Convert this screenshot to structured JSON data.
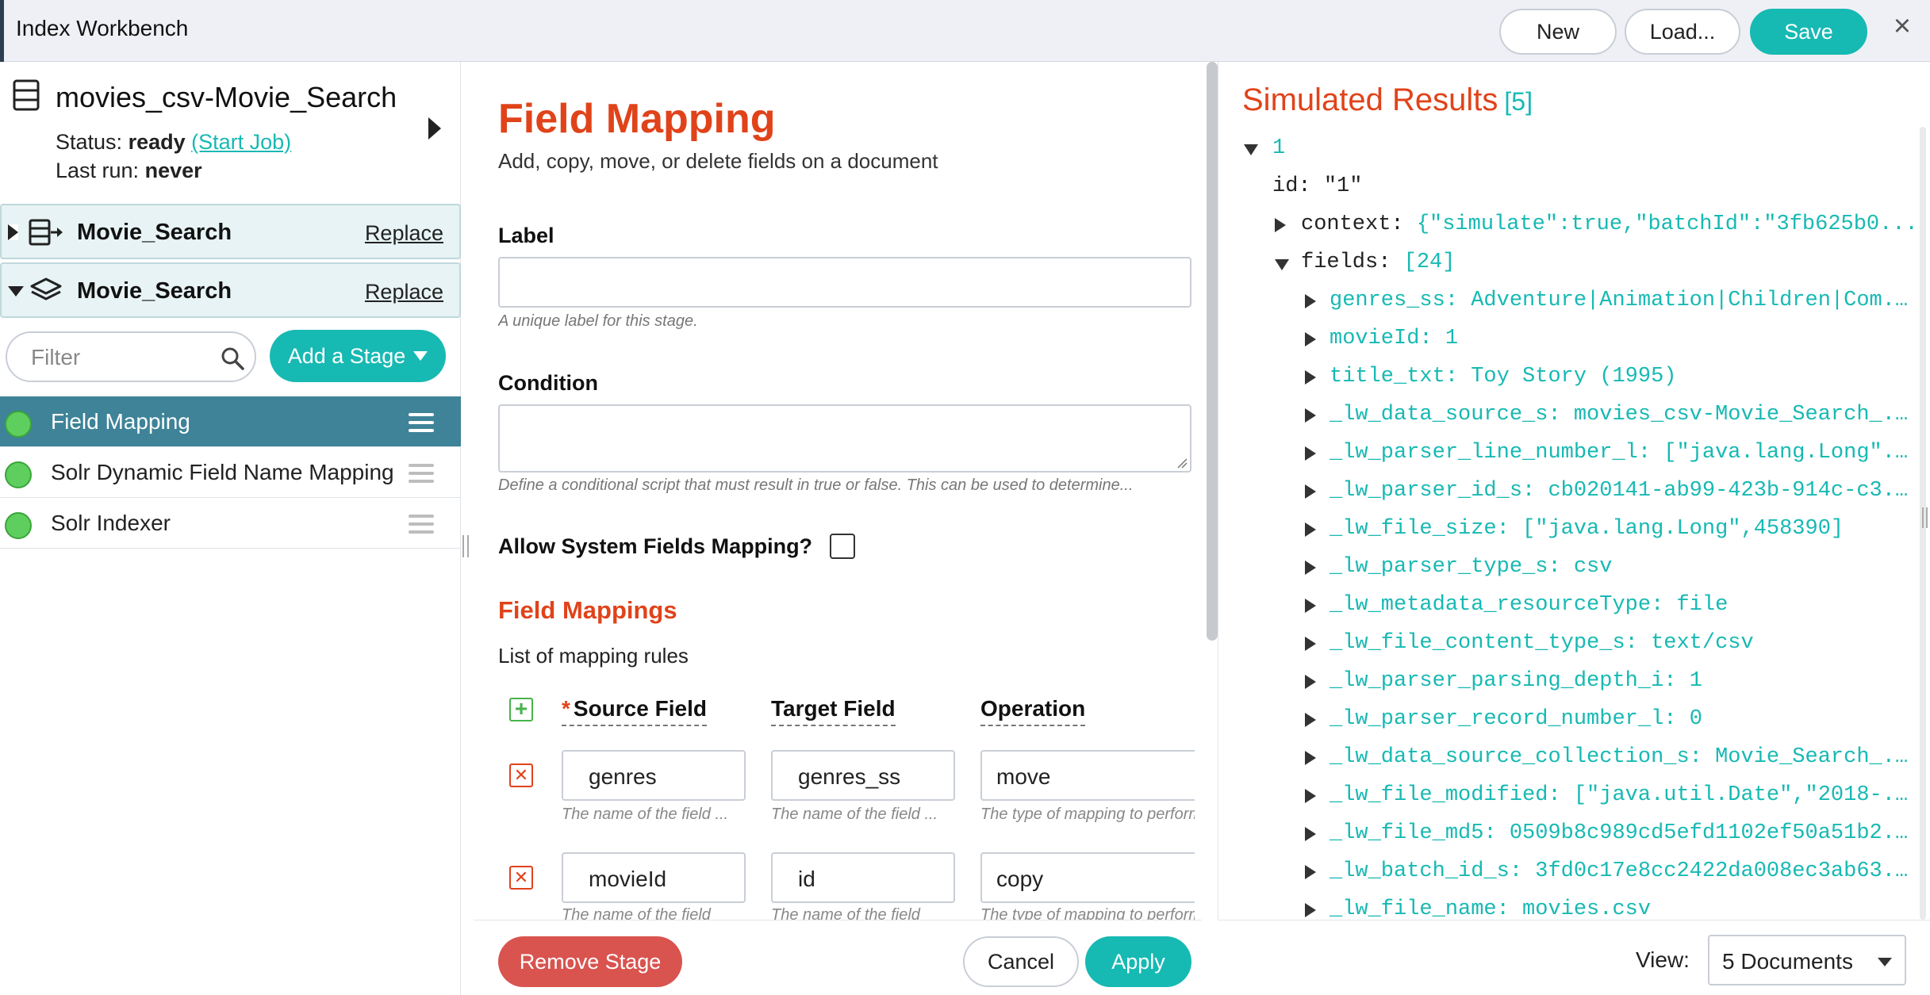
{
  "topbar": {
    "title": "Index Workbench",
    "new_label": "New",
    "load_label": "Load...",
    "save_label": "Save",
    "close_symbol": "×"
  },
  "pipeline": {
    "name": "movies_csv-Movie_Search",
    "status_label": "Status:",
    "status_value": "ready",
    "start_job_label": "(Start Job)",
    "last_run_label": "Last run:",
    "last_run_value": "never"
  },
  "sections": [
    {
      "title": "Movie_Search",
      "action": "Replace",
      "icon": "datasource-icon",
      "expanded": false
    },
    {
      "title": "Movie_Search",
      "action": "Replace",
      "icon": "layers-icon",
      "expanded": true
    }
  ],
  "filter": {
    "placeholder": "Filter"
  },
  "add_stage_label": "Add a Stage",
  "stages": [
    {
      "name": "Field Mapping",
      "active": true
    },
    {
      "name": "Solr Dynamic Field Name Mapping",
      "active": false
    },
    {
      "name": "Solr Indexer",
      "active": false
    }
  ],
  "form": {
    "title": "Field Mapping",
    "subtitle": "Add, copy, move, or delete fields on a document",
    "label_title": "Label",
    "label_value": "",
    "label_hint": "A unique label for this stage.",
    "condition_title": "Condition",
    "condition_value": "",
    "condition_hint": "Define a conditional script that must result in true or false. This can be used to determine...",
    "allow_system_label": "Allow System Fields Mapping?",
    "allow_system_checked": false,
    "mappings_title": "Field Mappings",
    "mappings_sub": "List of mapping rules",
    "columns": {
      "required_mark": "*",
      "source": "Source Field",
      "target": "Target Field",
      "operation": "Operation"
    },
    "rows": [
      {
        "source": "genres",
        "target": "genres_ss",
        "operation": "move",
        "source_hint": "The name of the field ...",
        "target_hint": "The name of the field ...",
        "operation_hint": "The type of mapping to perform"
      },
      {
        "source": "movieId",
        "target": "id",
        "operation": "copy",
        "source_hint": "The name of the field",
        "target_hint": "The name of the field",
        "operation_hint": "The type of mapping to perform"
      }
    ],
    "remove_label": "Remove Stage",
    "cancel_label": "Cancel",
    "apply_label": "Apply"
  },
  "results": {
    "title": "Simulated Results",
    "count": "[5]",
    "doc_index": "1",
    "id_key": "id:",
    "id_value": "\"1\"",
    "context_key": "context:",
    "context_value": "{\"simulate\":true,\"batchId\":\"3fb625b0...",
    "fields_key": "fields:",
    "fields_count": "[24]",
    "fields": [
      {
        "key": "genres_ss:",
        "value": "Adventure|Animation|Children|Com..."
      },
      {
        "key": "movieId:",
        "value": "1"
      },
      {
        "key": "title_txt:",
        "value": "Toy Story (1995)"
      },
      {
        "key": "_lw_data_source_s:",
        "value": "movies_csv-Movie_Search_..."
      },
      {
        "key": "_lw_parser_line_number_l:",
        "value": "[\"java.lang.Long\"..."
      },
      {
        "key": "_lw_parser_id_s:",
        "value": "cb020141-ab99-423b-914c-c3..."
      },
      {
        "key": "_lw_file_size:",
        "value": "[\"java.lang.Long\",458390]"
      },
      {
        "key": "_lw_parser_type_s:",
        "value": "csv"
      },
      {
        "key": "_lw_metadata_resourceType:",
        "value": "file"
      },
      {
        "key": "_lw_file_content_type_s:",
        "value": "text/csv"
      },
      {
        "key": "_lw_parser_parsing_depth_i:",
        "value": "1"
      },
      {
        "key": "_lw_parser_record_number_l:",
        "value": "0"
      },
      {
        "key": "_lw_data_source_collection_s:",
        "value": "Movie_Search_..."
      },
      {
        "key": "_lw_file_modified:",
        "value": "[\"java.util.Date\",\"2018-..."
      },
      {
        "key": "_lw_file_md5:",
        "value": "0509b8c989cd5efd1102ef50a51b2..."
      },
      {
        "key": "_lw_batch_id_s:",
        "value": "3fd0c17e8cc2422da008ec3ab63..."
      },
      {
        "key": "_lw_file_name:",
        "value": "movies.csv"
      }
    ],
    "view_label": "View:",
    "view_value": "5 Documents"
  },
  "colors": {
    "accent_teal": "#17b9b3",
    "title_red": "#e0431a",
    "active_stage": "#3e8398",
    "status_green": "#5ecf5e",
    "remove_red": "#d9534f"
  }
}
